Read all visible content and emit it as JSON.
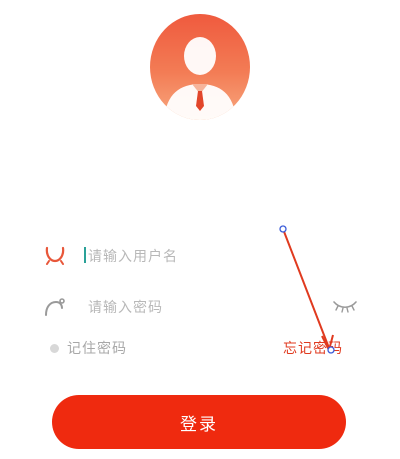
{
  "form": {
    "username_placeholder": "请输入用户名",
    "password_placeholder": "请输入密码",
    "remember_label": "记住密码",
    "forgot_label": "忘记密码"
  },
  "login_button": {
    "label": "登录"
  },
  "icons": {
    "avatar": "user-avatar-icon",
    "username": "user-icon",
    "password": "lock-icon",
    "toggle_password": "eye-closed-icon"
  },
  "colors": {
    "accent": "#ef2a0f",
    "accent_text": "#e03a1f",
    "avatar_top": "#ef5a3e",
    "avatar_bottom": "#f8a87f",
    "placeholder": "#b8b8b8",
    "icon_gray": "#9a9a9a"
  }
}
